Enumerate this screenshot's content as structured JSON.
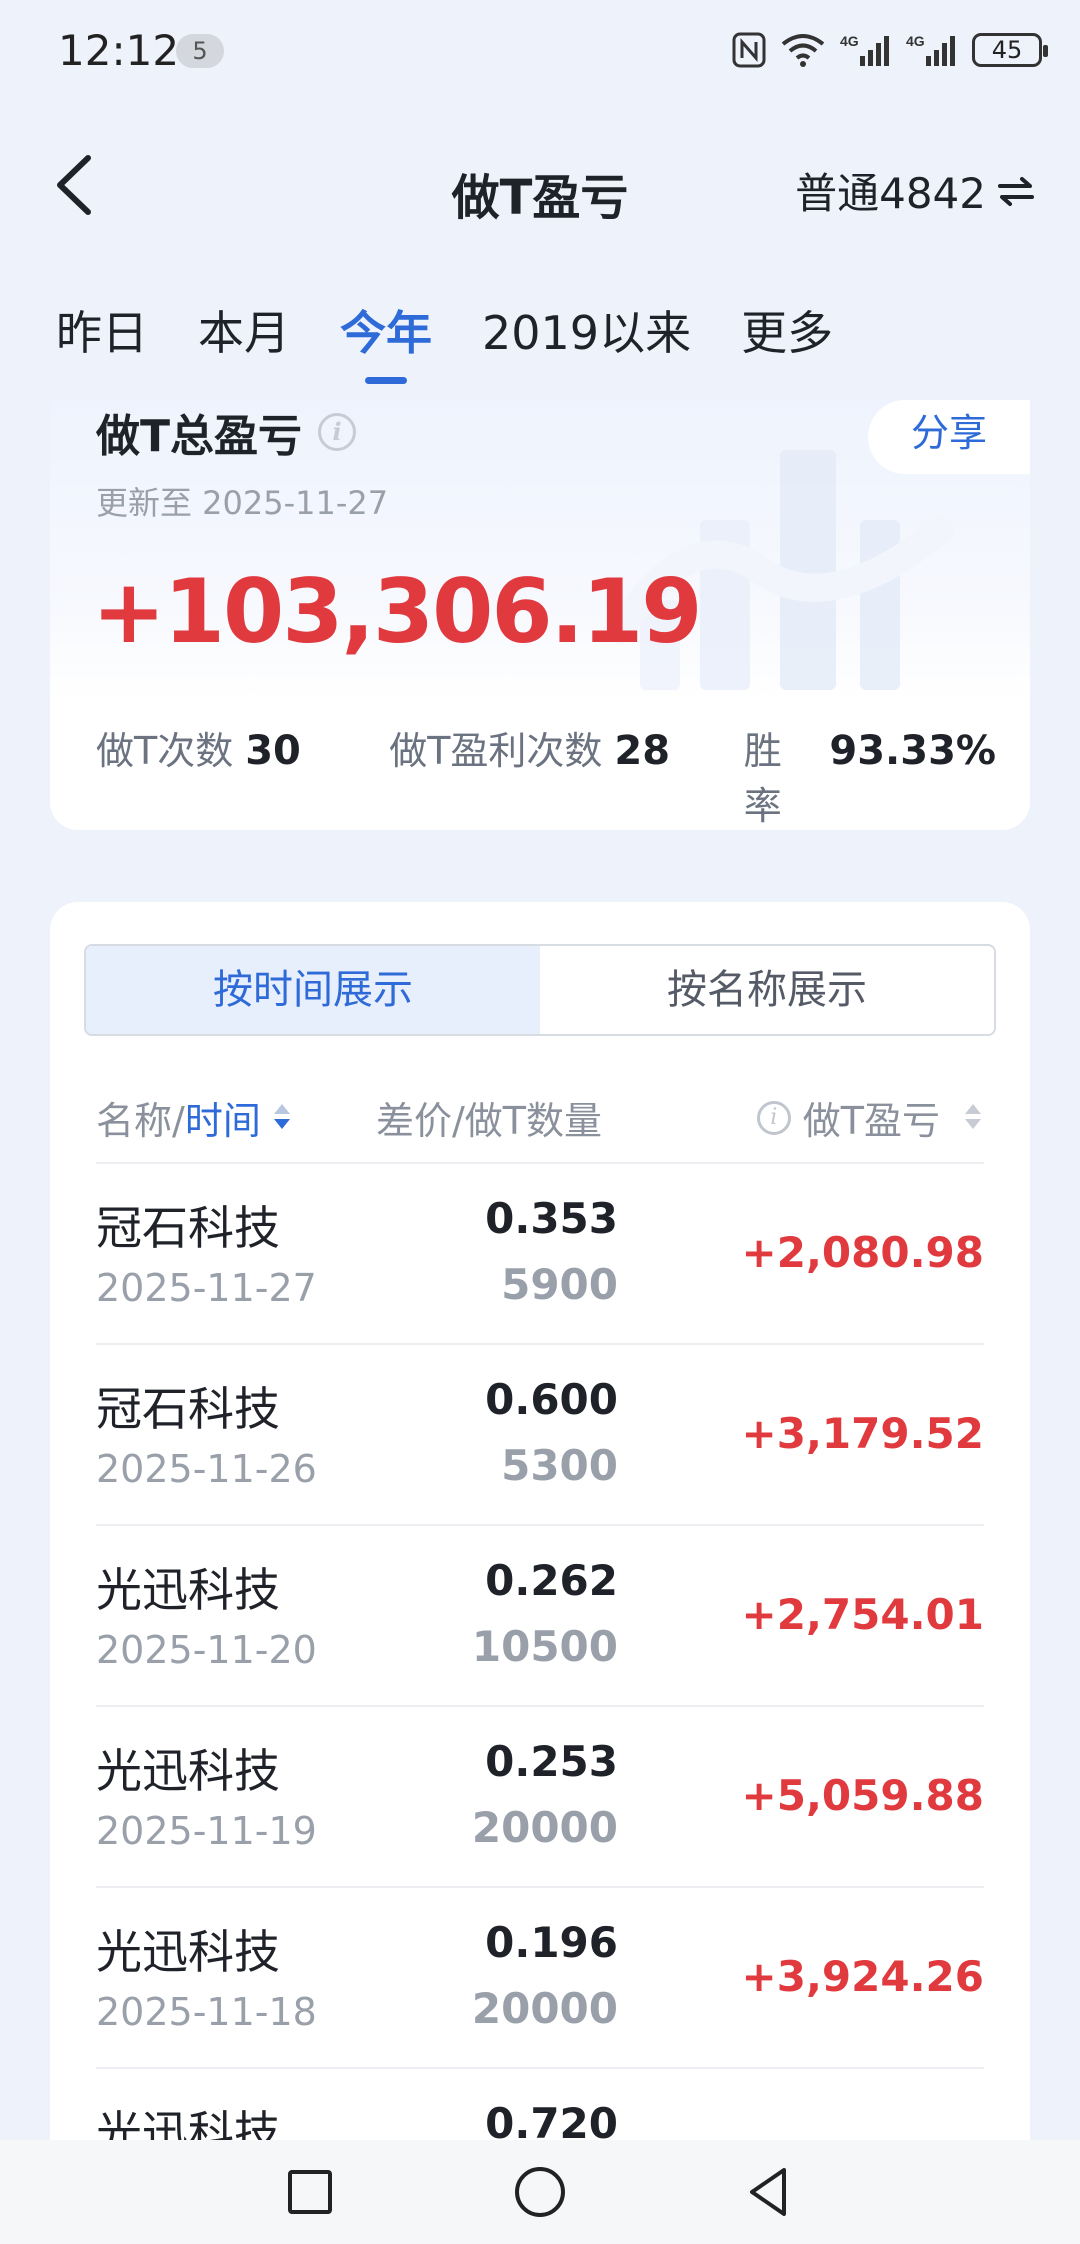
{
  "status_bar": {
    "time": "12:12",
    "notification_count": "5",
    "battery": "45",
    "icons": [
      "nfc-icon",
      "wifi-icon",
      "signal-4g-icon",
      "signal-4g-icon",
      "battery-icon"
    ]
  },
  "header": {
    "title": "做T盈亏",
    "account": "普通4842",
    "switch_icon": "swap-arrows-icon"
  },
  "tabs": [
    {
      "label": "昨日"
    },
    {
      "label": "本月"
    },
    {
      "label": "今年",
      "active": true
    },
    {
      "label": "2019以来"
    },
    {
      "label": "更多"
    }
  ],
  "summary": {
    "title": "做T总盈亏",
    "share_label": "分享",
    "update_text": "更新至 2025-11-27",
    "total": "+103,306.19",
    "stats": [
      {
        "label": "做T次数",
        "value": "30"
      },
      {
        "label": "做T盈利次数",
        "value": "28"
      },
      {
        "label": "胜率",
        "value": "93.33%"
      }
    ]
  },
  "segments": [
    {
      "label": "按时间展示",
      "active": true
    },
    {
      "label": "按名称展示"
    }
  ],
  "columns": {
    "name_part": "名称/",
    "time_part": "时间",
    "diff": "差价/做T数量",
    "pl": "做T盈亏"
  },
  "records": [
    {
      "name": "冠石科技",
      "date": "2025-11-27",
      "diff": "0.353",
      "qty": "5900",
      "pl": "+2,080.98"
    },
    {
      "name": "冠石科技",
      "date": "2025-11-26",
      "diff": "0.600",
      "qty": "5300",
      "pl": "+3,179.52"
    },
    {
      "name": "光迅科技",
      "date": "2025-11-20",
      "diff": "0.262",
      "qty": "10500",
      "pl": "+2,754.01"
    },
    {
      "name": "光迅科技",
      "date": "2025-11-19",
      "diff": "0.253",
      "qty": "20000",
      "pl": "+5,059.88"
    },
    {
      "name": "光迅科技",
      "date": "2025-11-18",
      "diff": "0.196",
      "qty": "20000",
      "pl": "+3,924.26"
    },
    {
      "name": "光迅科技",
      "date": "",
      "diff": "0.720",
      "qty": "",
      "pl": ""
    }
  ],
  "colors": {
    "accent": "#2f6bd8",
    "profit": "#e03a3f",
    "background": "#eef2fb"
  }
}
